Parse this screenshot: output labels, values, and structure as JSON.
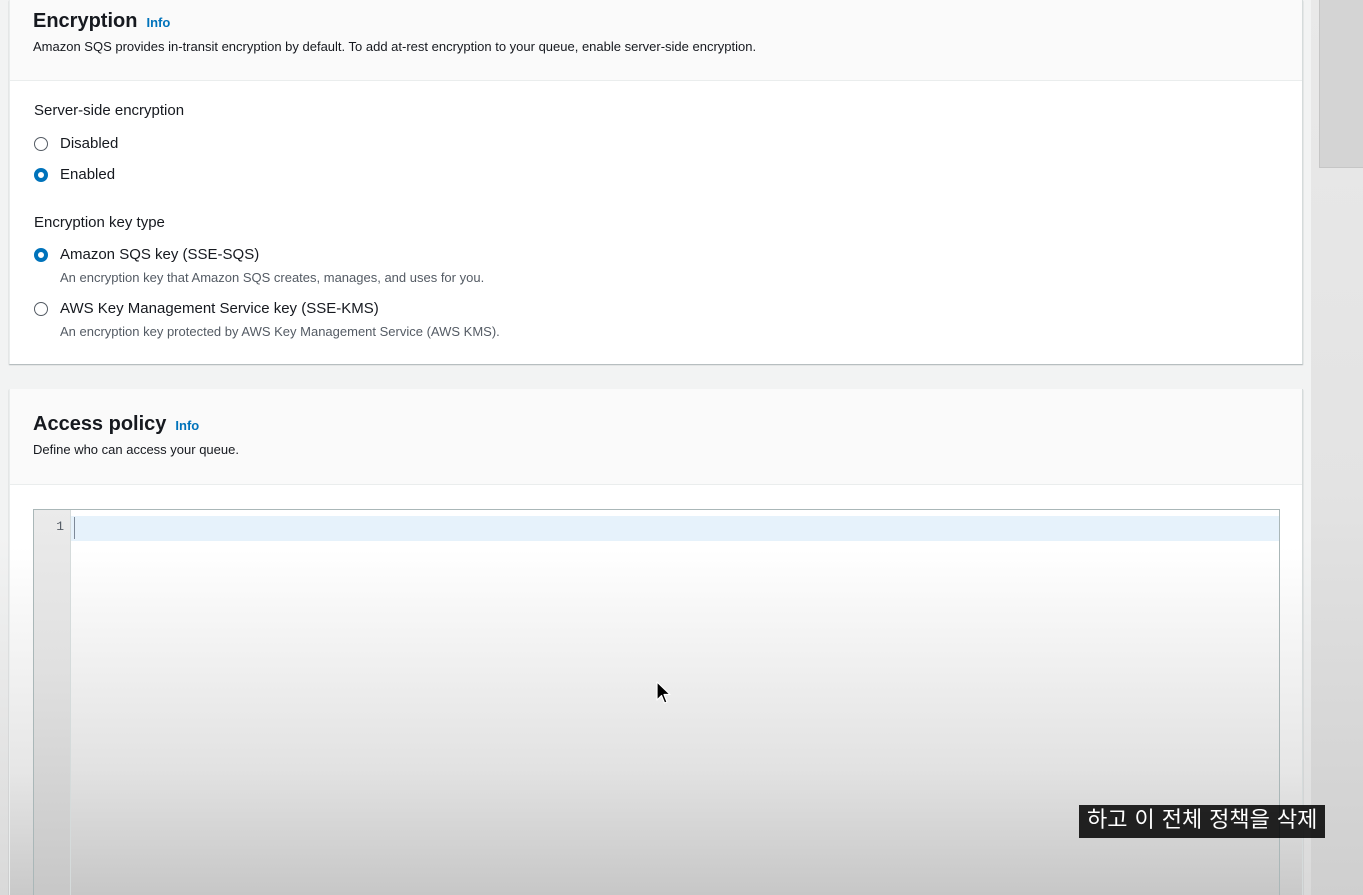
{
  "encryption": {
    "title": "Encryption",
    "info_label": "Info",
    "description": "Amazon SQS provides in-transit encryption by default. To add at-rest encryption to your queue, enable server-side encryption.",
    "sse_label": "Server-side encryption",
    "sse_options": [
      {
        "label": "Disabled",
        "checked": false
      },
      {
        "label": "Enabled",
        "checked": true
      }
    ],
    "key_type_label": "Encryption key type",
    "key_options": [
      {
        "label": "Amazon SQS key (SSE-SQS)",
        "description": "An encryption key that Amazon SQS creates, manages, and uses for you.",
        "checked": true
      },
      {
        "label": "AWS Key Management Service key (SSE-KMS)",
        "description": "An encryption key protected by AWS Key Management Service (AWS KMS).",
        "checked": false
      }
    ]
  },
  "access_policy": {
    "title": "Access policy",
    "info_label": "Info",
    "description": "Define who can access your queue.",
    "editor": {
      "line_numbers": [
        "1"
      ],
      "content": ""
    }
  },
  "subtitle": "하고 이 전체 정책을 삭제",
  "colors": {
    "accent": "#0073bb",
    "text": "#16191f",
    "secondary_text": "#545b64"
  }
}
